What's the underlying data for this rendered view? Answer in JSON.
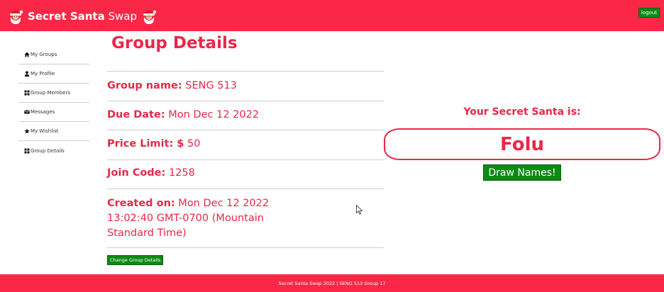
{
  "header": {
    "brand_bold": "Secret Santa",
    "brand_light": "Swap",
    "logout_label": "logout"
  },
  "sidebar": {
    "items": [
      {
        "label": "My Groups",
        "icon": "home-icon"
      },
      {
        "label": "My Profile",
        "icon": "user-icon"
      },
      {
        "label": "Group Members",
        "icon": "grid-icon"
      },
      {
        "label": "Messages",
        "icon": "envelope-icon"
      },
      {
        "label": "My Wishlist",
        "icon": "star-icon"
      },
      {
        "label": "Group Details",
        "icon": "grid-icon"
      }
    ]
  },
  "main": {
    "title": "Group Details",
    "group_name_label": "Group name:",
    "group_name": "SENG 513",
    "due_date_label": "Due Date:",
    "due_date": "Mon Dec 12 2022",
    "price_limit_label": "Price Limit: $",
    "price_limit": "50",
    "join_code_label": "Join Code:",
    "join_code": "1258",
    "created_on_label": "Created on:",
    "created_on": "Mon Dec 12 2022 13:02:40 GMT-0700 (Mountain Standard Time)",
    "change_button_label": "Change Group Details"
  },
  "secret_santa": {
    "label": "Your Secret Santa is:",
    "name": "Folu",
    "draw_button_label": "Draw Names!"
  },
  "footer": {
    "text": "Secret Santa Swap 2022 | SENG 513 Group 17"
  },
  "colors": {
    "brand_red": "#fa2846",
    "text_red": "#e8284a",
    "button_green": "#0d8a13"
  }
}
